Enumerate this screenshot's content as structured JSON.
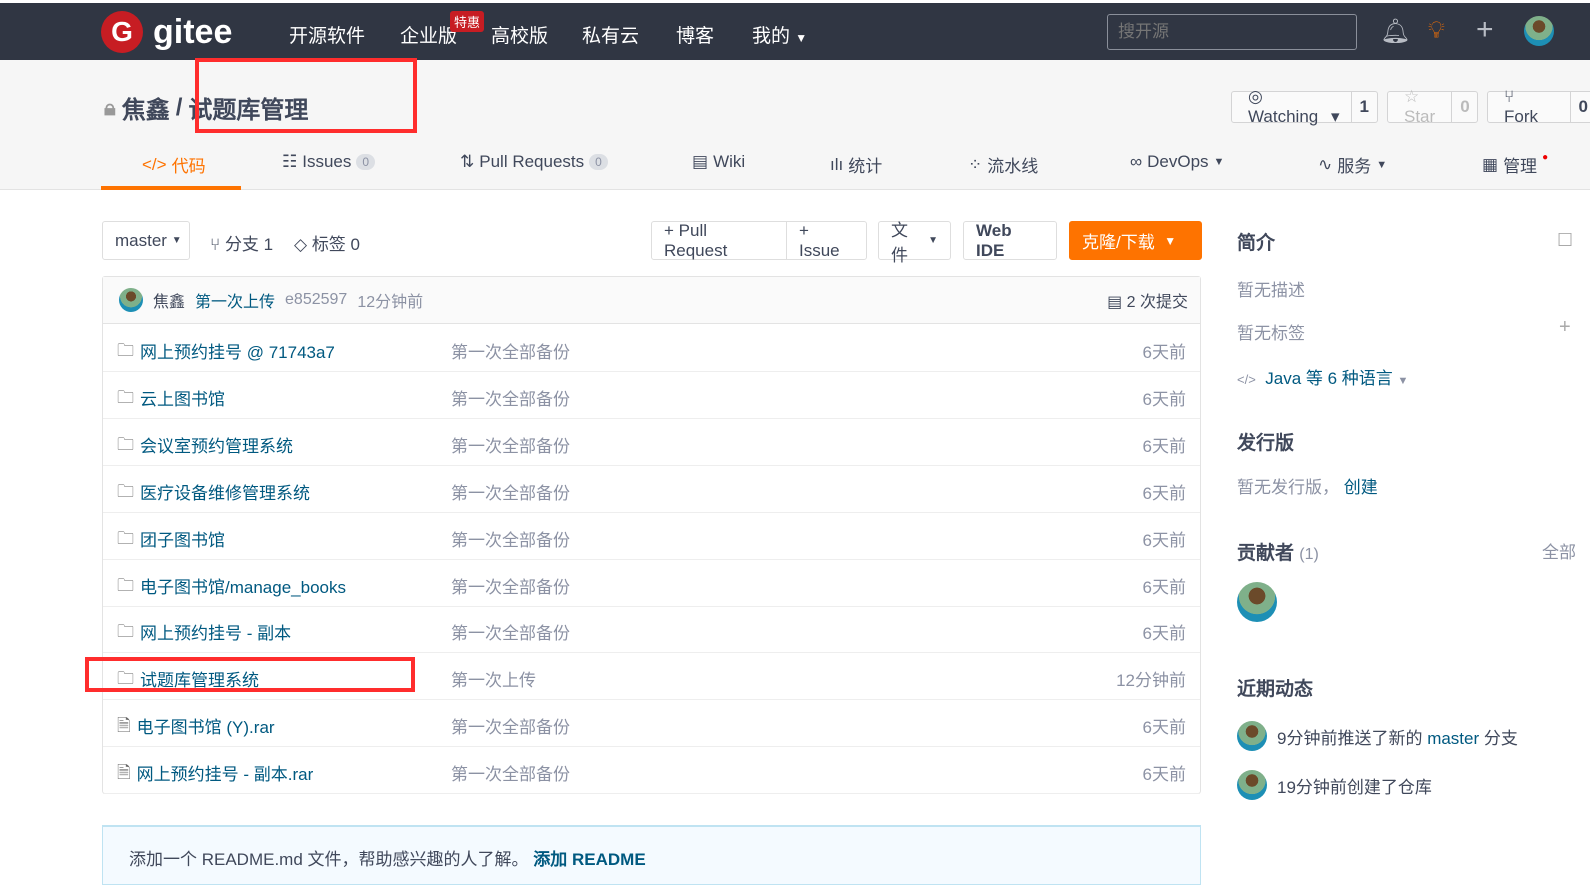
{
  "nav": {
    "logo": "gitee",
    "items": [
      "开源软件",
      "企业版",
      "高校版",
      "私有云",
      "博客",
      "我的"
    ],
    "badge": "特惠",
    "search_placeholder": "搜开源"
  },
  "repo": {
    "owner": "焦鑫",
    "sep": "/",
    "name": "试题库管理",
    "watch": "Watching",
    "watch_count": "1",
    "star": "Star",
    "star_count": "0",
    "fork": "Fork",
    "fork_count": "0"
  },
  "tabs": [
    {
      "label": "代码"
    },
    {
      "label": "Issues",
      "count": "0"
    },
    {
      "label": "Pull Requests",
      "count": "0"
    },
    {
      "label": "Wiki"
    },
    {
      "label": "统计"
    },
    {
      "label": "流水线"
    },
    {
      "label": "DevOps"
    },
    {
      "label": "服务"
    },
    {
      "label": "管理"
    }
  ],
  "toolbar": {
    "branch": "master",
    "branches": "分支 1",
    "tags": "标签 0",
    "pr": "+ Pull Request",
    "issue": "+ Issue",
    "file": "文件",
    "webide": "Web IDE",
    "clone": "克隆/下载"
  },
  "commit": {
    "author": "焦鑫",
    "message": "第一次上传",
    "hash": "e852597",
    "time": "12分钟前",
    "count": "2 次提交"
  },
  "files": [
    {
      "name": "网上预约挂号 @ 71743a7",
      "type": "submodule",
      "msg": "第一次全部备份",
      "time": "6天前"
    },
    {
      "name": "云上图书馆",
      "type": "folder",
      "msg": "第一次全部备份",
      "time": "6天前"
    },
    {
      "name": "会议室预约管理系统",
      "type": "folder",
      "msg": "第一次全部备份",
      "time": "6天前"
    },
    {
      "name": "医疗设备维修管理系统",
      "type": "folder",
      "msg": "第一次全部备份",
      "time": "6天前"
    },
    {
      "name": "团子图书馆",
      "type": "folder",
      "msg": "第一次全部备份",
      "time": "6天前"
    },
    {
      "name": "电子图书馆/manage_books",
      "type": "folder",
      "msg": "第一次全部备份",
      "time": "6天前"
    },
    {
      "name": "网上预约挂号 - 副本",
      "type": "folder",
      "msg": "第一次全部备份",
      "time": "6天前"
    },
    {
      "name": "试题库管理系统",
      "type": "folder",
      "msg": "第一次上传",
      "time": "12分钟前"
    },
    {
      "name": "电子图书馆 (Y).rar",
      "type": "file",
      "msg": "第一次全部备份",
      "time": "6天前"
    },
    {
      "name": "网上预约挂号 - 副本.rar",
      "type": "file",
      "msg": "第一次全部备份",
      "time": "6天前"
    }
  ],
  "readme": {
    "text": "添加一个 README.md 文件，帮助感兴趣的人了解。",
    "link": "添加 README"
  },
  "sidebar": {
    "intro": "简介",
    "no_desc": "暂无描述",
    "no_tags": "暂无标签",
    "lang": "Java 等 6 种语言",
    "release": "发行版",
    "no_release": "暂无发行版，",
    "create": "创建",
    "contrib": "贡献者",
    "contrib_count": "(1)",
    "all": "全部",
    "activity": "近期动态",
    "act1_pre": "9分钟前推送了新的 ",
    "act1_branch": "master",
    "act1_post": " 分支",
    "act2": "19分钟前创建了仓库"
  },
  "colors": {
    "nav": "#303643",
    "accent": "#fe7300",
    "link": "#005980",
    "highlight": "#ff2d2d"
  }
}
